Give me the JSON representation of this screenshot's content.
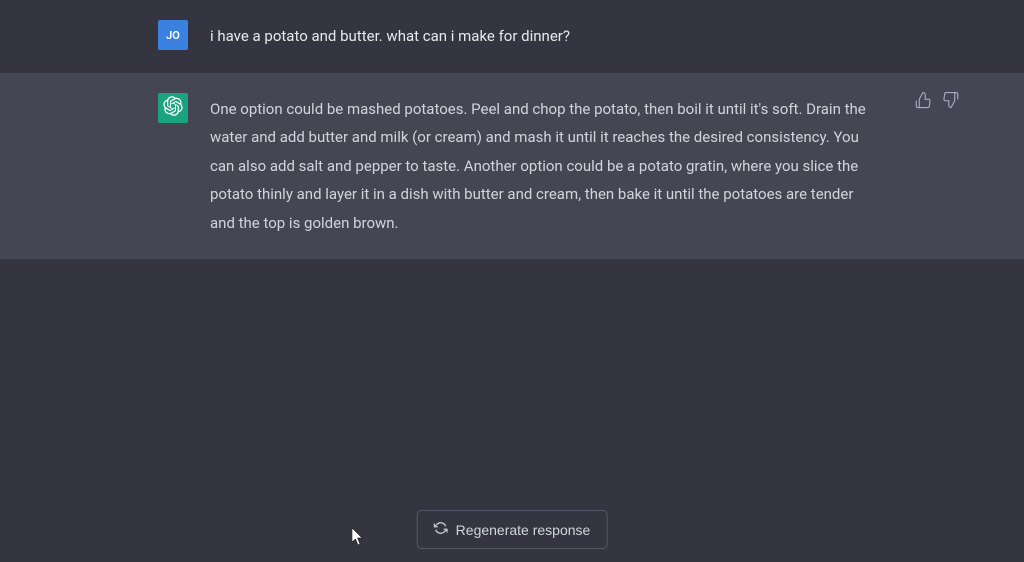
{
  "user": {
    "avatar_initials": "JO",
    "message": "i have a potato and butter. what can i make for dinner?"
  },
  "assistant": {
    "message": "One option could be mashed potatoes. Peel and chop the potato, then boil it until it's soft. Drain the water and add butter and milk (or cream) and mash it until it reaches the desired consistency. You can also add salt and pepper to taste. Another option could be a potato gratin, where you slice the potato thinly and layer it in a dish with butter and cream, then bake it until the potatoes are tender and the top is golden brown."
  },
  "controls": {
    "regenerate_label": "Regenerate response"
  }
}
